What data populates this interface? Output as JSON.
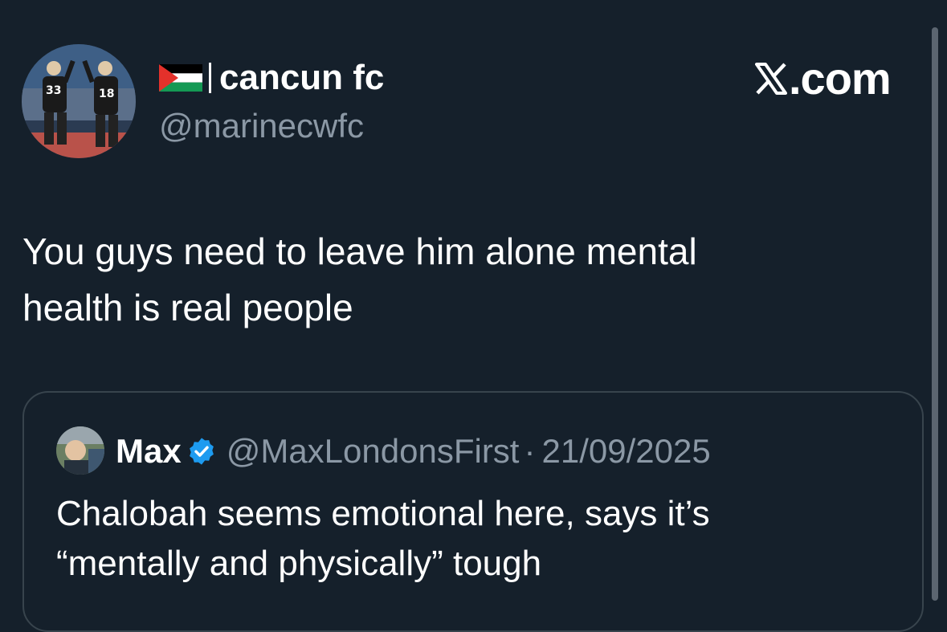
{
  "author": {
    "flag_icon": "palestine-flag-icon",
    "display_name": "cancun fc",
    "handle": "@marinecwfc"
  },
  "brand": {
    "text": ".com",
    "icon": "x-logo-icon"
  },
  "tweet": {
    "lines": [
      "You guys need to leave him alone mental",
      "health is real people"
    ]
  },
  "quote": {
    "name": "Max",
    "verified_icon": "verified-badge-icon",
    "handle": "@MaxLondonsFirst",
    "separator": "·",
    "date": "21/09/2025",
    "lines": [
      "Chalobah seems emotional here, says it’s",
      "“mentally and physically” tough"
    ]
  },
  "colors": {
    "background": "#15202b",
    "secondary_text": "#8b98a5",
    "border": "#38444d",
    "verified_blue": "#1d9bf0"
  }
}
